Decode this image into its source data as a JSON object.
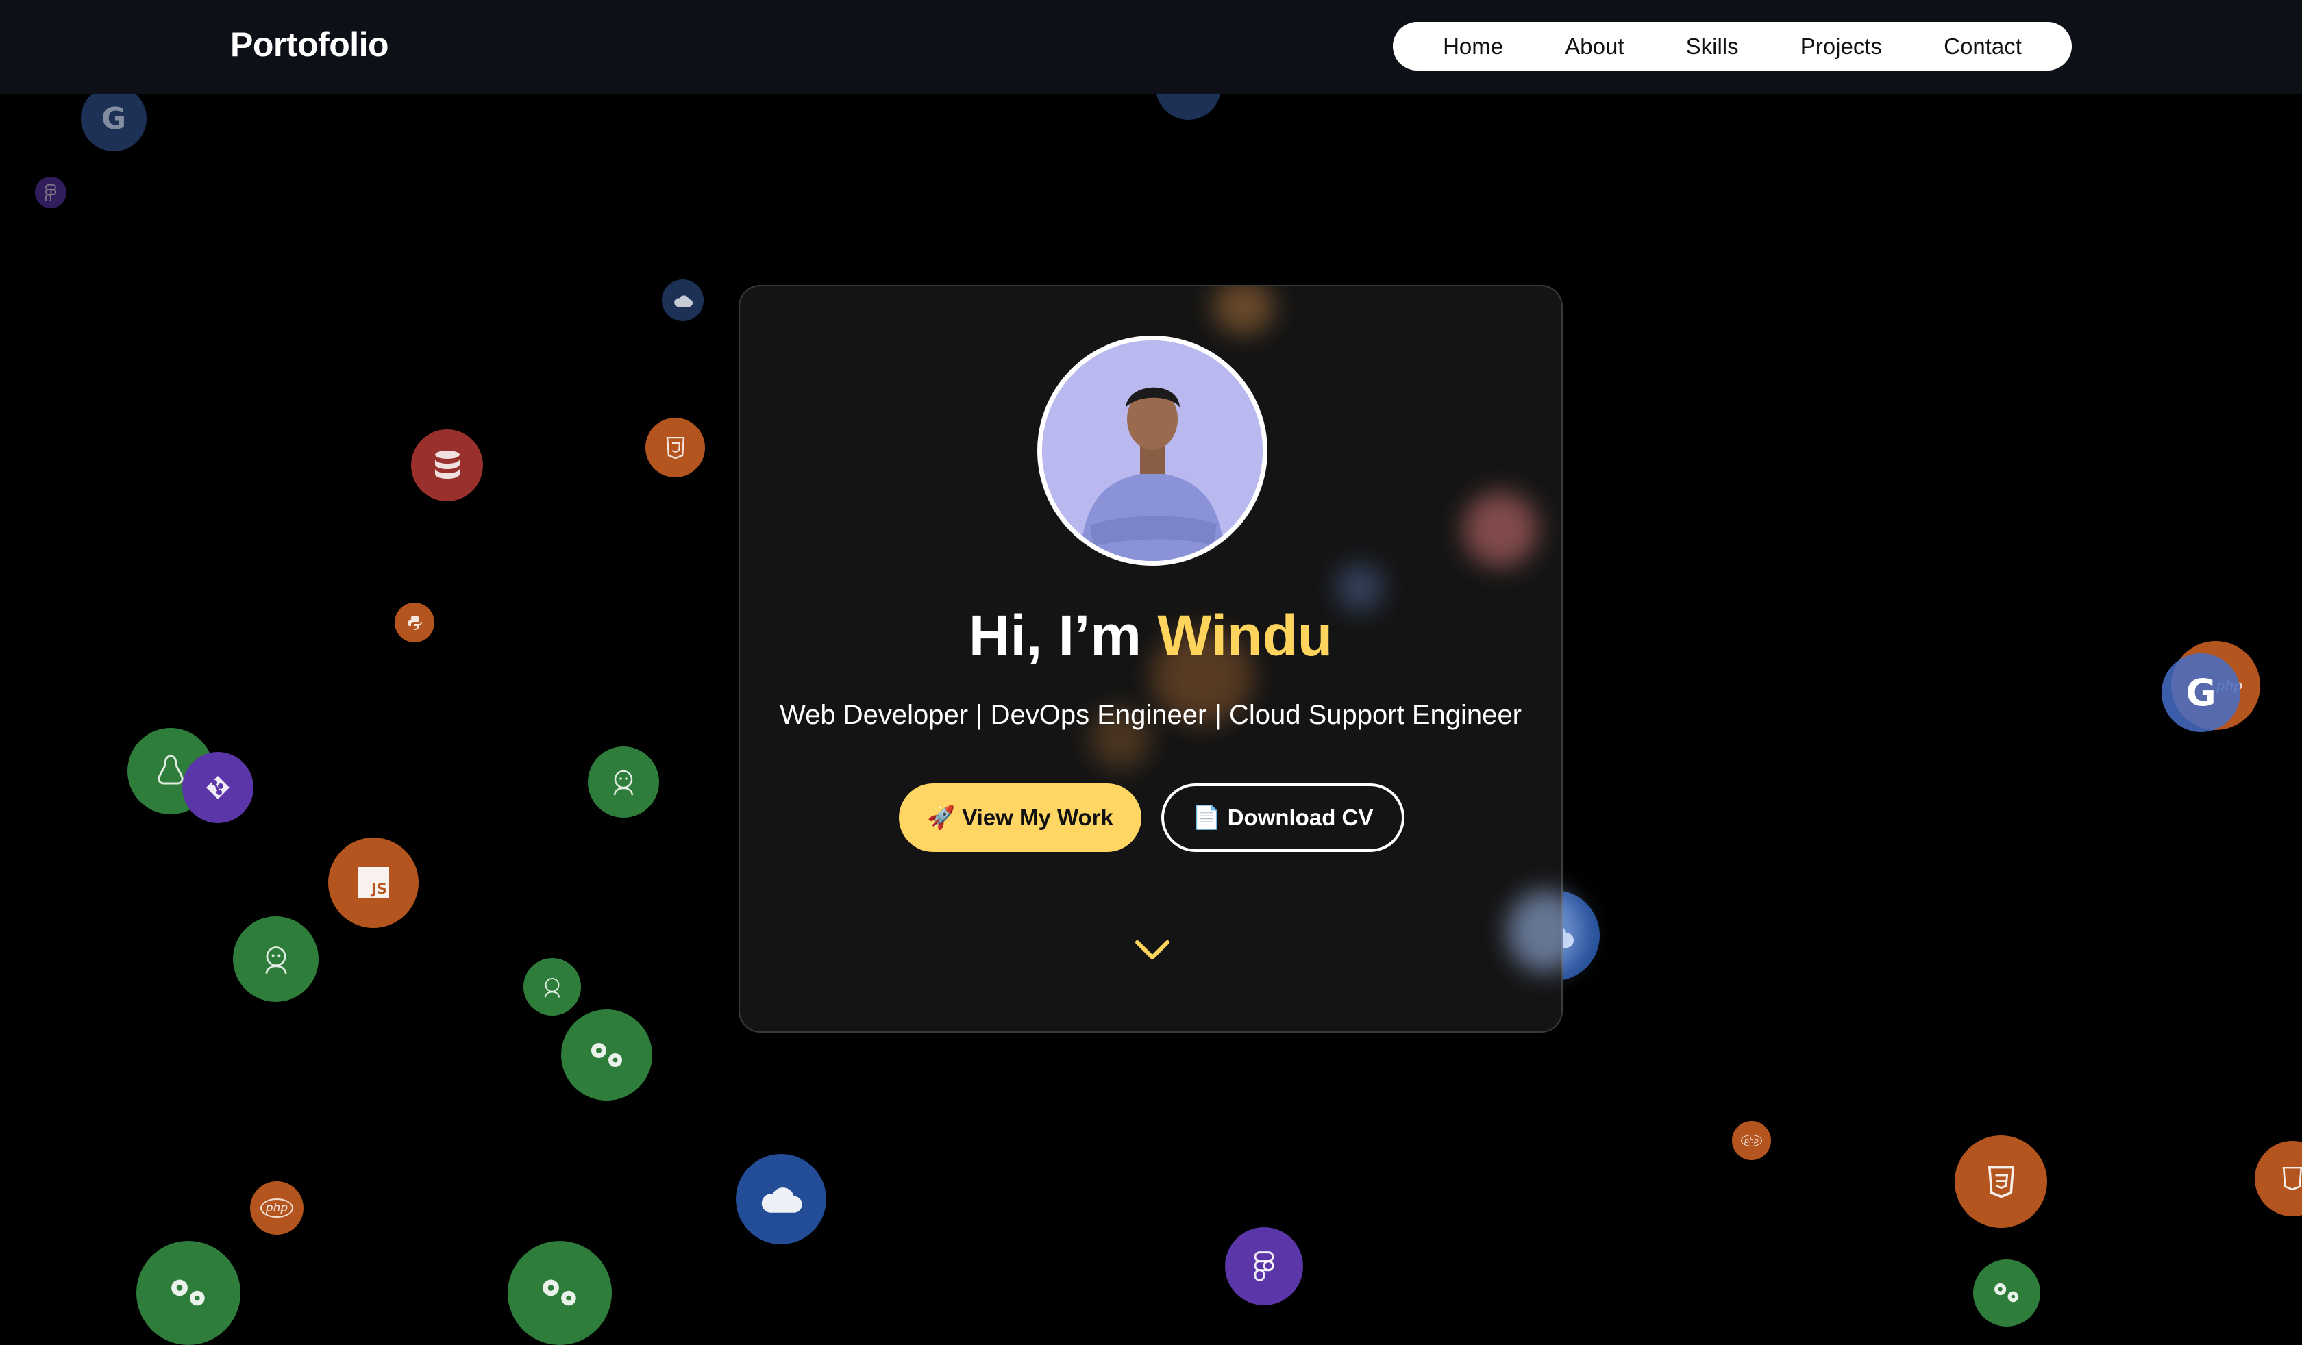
{
  "brand": "Portofolio",
  "nav": {
    "items": [
      {
        "label": "Home"
      },
      {
        "label": "About"
      },
      {
        "label": "Skills"
      },
      {
        "label": "Projects"
      },
      {
        "label": "Contact"
      }
    ]
  },
  "hero": {
    "greeting": "Hi, I’m ",
    "name": "Windu",
    "subtitle": "Web Developer | DevOps Engineer | Cloud Support Engineer",
    "primary_button": {
      "icon": "🚀",
      "label": "View My Work"
    },
    "secondary_button": {
      "icon": "📄",
      "label": "Download CV"
    },
    "scroll_icon": "chevron-down-icon"
  },
  "colors": {
    "accent": "#ffd45c",
    "nav_bg": "#0d1117",
    "card_bg": "#141414",
    "page_bg": "#000000"
  },
  "background_icons": {
    "google": "G",
    "javascript": "JS",
    "php": "php"
  }
}
